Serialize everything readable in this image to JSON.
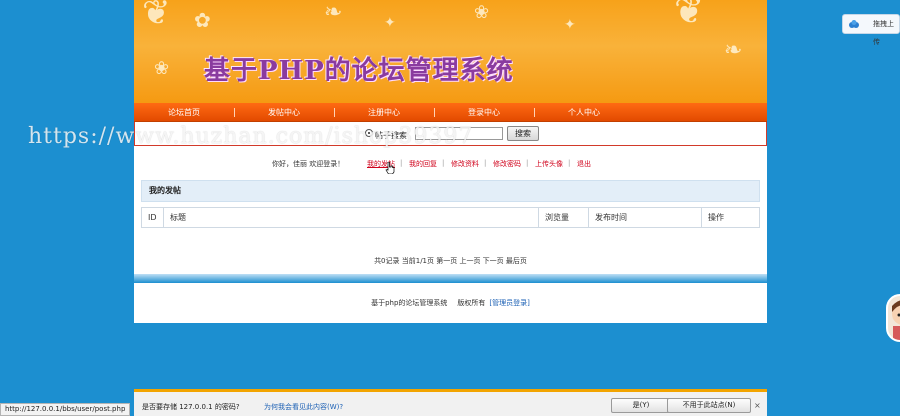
{
  "header": {
    "site_title": "基于PHP的论坛管理系统"
  },
  "nav": {
    "items": [
      "论坛首页",
      "发帖中心",
      "注册中心",
      "登录中心",
      "个人中心"
    ]
  },
  "search": {
    "radio_label": "帖子搜索",
    "input_value": "",
    "button_label": "搜索"
  },
  "user_bar": {
    "welcome": "你好，佳丽 欢迎登录！",
    "links": [
      "我的发帖",
      "我的回复",
      "修改资料",
      "修改密码",
      "上传头像",
      "退出"
    ]
  },
  "posts": {
    "section_title": "我的发帖",
    "columns": [
      "ID",
      "标题",
      "浏览量",
      "发布时间",
      "操作"
    ],
    "rows": []
  },
  "pager": {
    "text": "共0记录  当前1/1页  第一页 上一页 下一页 最后页"
  },
  "footer": {
    "system_name": "基于php的论坛管理系统",
    "copyright": "版权所有",
    "admin_link": "[管理员登录]"
  },
  "browser": {
    "status_url": "http://127.0.0.1/bbs/user/post.php",
    "save_prompt": "是否要存储 127.0.0.1 的密码?",
    "why_link": "为何我会看见此内容(W)?",
    "yes_button": "是(Y)",
    "never_button": "不用于此站点(N)",
    "close_glyph": "×"
  },
  "side_widget": {
    "label": "拖拽上传"
  },
  "watermark": "https://www.huzhan.com/ishop39397",
  "colors": {
    "page_bg": "#1c8fd0",
    "banner_orange": "#f7a21a",
    "nav_orange": "#ff6a13",
    "title_purple": "#8a3b9f",
    "link_red": "#d0021b"
  }
}
